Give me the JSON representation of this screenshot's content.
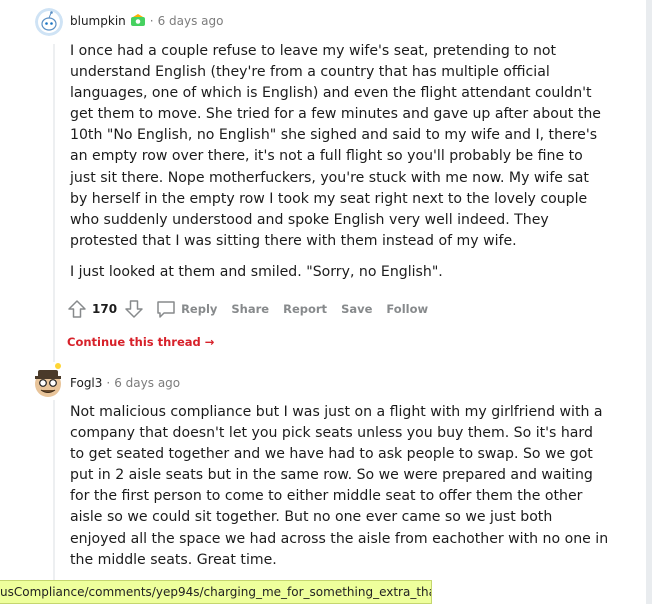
{
  "comments": [
    {
      "username": "blumpkin",
      "separator": "·",
      "time": "6 days ago",
      "paragraphs": [
        "I once had a couple refuse to leave my wife's seat, pretending to not understand English (they're from a country that has multiple official languages, one of which is English) and even the flight attendant couldn't get them to move. She tried for a few minutes and gave up after about the 10th \"No English, no English\" she sighed and said to my wife and I, there's an empty row over there, it's not a full flight so you'll probably be fine to just sit there. Nope motherfuckers, you're stuck with me now. My wife sat by herself in the empty row I took my seat right next to the lovely couple who suddenly understood and spoke English very well indeed. They protested that I was sitting there with them instead of my wife.",
        "I just looked at them and smiled. \"Sorry, no English\"."
      ],
      "score": "170",
      "actions": {
        "reply": "Reply",
        "share": "Share",
        "report": "Report",
        "save": "Save",
        "follow": "Follow"
      },
      "continue_label": "Continue this thread"
    },
    {
      "username": "Fogl3",
      "separator": "·",
      "time": "6 days ago",
      "paragraphs": [
        "Not malicious compliance but I was just on a flight with my girlfriend with a company that doesn't let you pick seats unless you buy them. So it's hard to get seated together and we have had to ask people to swap. So we got put in 2 aisle seats but in the same row. So we were prepared and waiting for the first person to come to either middle seat to offer them the other aisle so we could sit together. But no one ever came so we just both enjoyed all the space we had across the aisle from eachother with no one in the middle seats. Great time."
      ]
    }
  ],
  "status_url": "usCompliance/comments/yep94s/charging_me_for_something_extra_that_never/",
  "colors": {
    "link_red": "#d7212a",
    "muted": "#878a8c",
    "status_bg": "#eeff9c"
  },
  "icons": [
    "snoo-avatar-icon",
    "flair-badge-icon",
    "upvote-icon",
    "downvote-icon",
    "comment-bubble-icon",
    "arrow-right-icon",
    "user-avatar-icon"
  ]
}
